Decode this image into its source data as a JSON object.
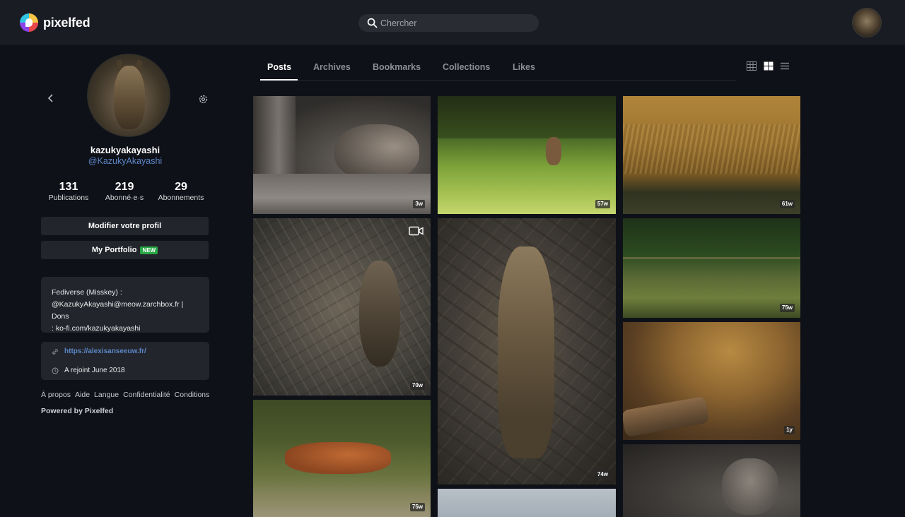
{
  "app": {
    "name": "pixelfed"
  },
  "search": {
    "placeholder": "Chercher"
  },
  "profile": {
    "username": "kazukyakayashi",
    "handle": "@KazukyAkayashi",
    "stats": [
      {
        "value": "131",
        "label": "Publications"
      },
      {
        "value": "219",
        "label": "Abonné·e·s"
      },
      {
        "value": "29",
        "label": "Abonnements"
      }
    ],
    "edit_button": "Modifier votre profil",
    "portfolio_button": "My Portfolio",
    "portfolio_badge": "NEW",
    "bio_line1": "Fediverse (Misskey) :",
    "bio_line2": "@KazukyAkayashi@meow.zarchbox.fr | Dons",
    "bio_line3": ": ko-fi.com/kazukyakayashi",
    "website": "https://alexisanseeuw.fr/",
    "joined": "A rejoint June 2018"
  },
  "footer": {
    "links": [
      "À propos",
      "Aide",
      "Langue",
      "Confidentialité",
      "Conditions"
    ],
    "powered": "Powered by Pixelfed"
  },
  "tabs": [
    "Posts",
    "Archives",
    "Bookmarks",
    "Collections",
    "Likes"
  ],
  "active_tab": "Posts",
  "posts": [
    {
      "subject": "cat",
      "age": "3w"
    },
    {
      "subject": "weasel",
      "age": "57w"
    },
    {
      "subject": "field",
      "age": "61w"
    },
    {
      "subject": "owl-branches",
      "age": "70w",
      "video": true
    },
    {
      "subject": "owl-tree",
      "age": "74w"
    },
    {
      "subject": "meadow",
      "age": "75w"
    },
    {
      "subject": "fox",
      "age": "75w"
    },
    {
      "subject": "insect-log",
      "age": "1y"
    },
    {
      "subject": "sky",
      "age": ""
    },
    {
      "subject": "cat-2",
      "age": ""
    }
  ],
  "colors": {
    "accent_link": "#5b86c6",
    "badge_green": "#28a745"
  }
}
